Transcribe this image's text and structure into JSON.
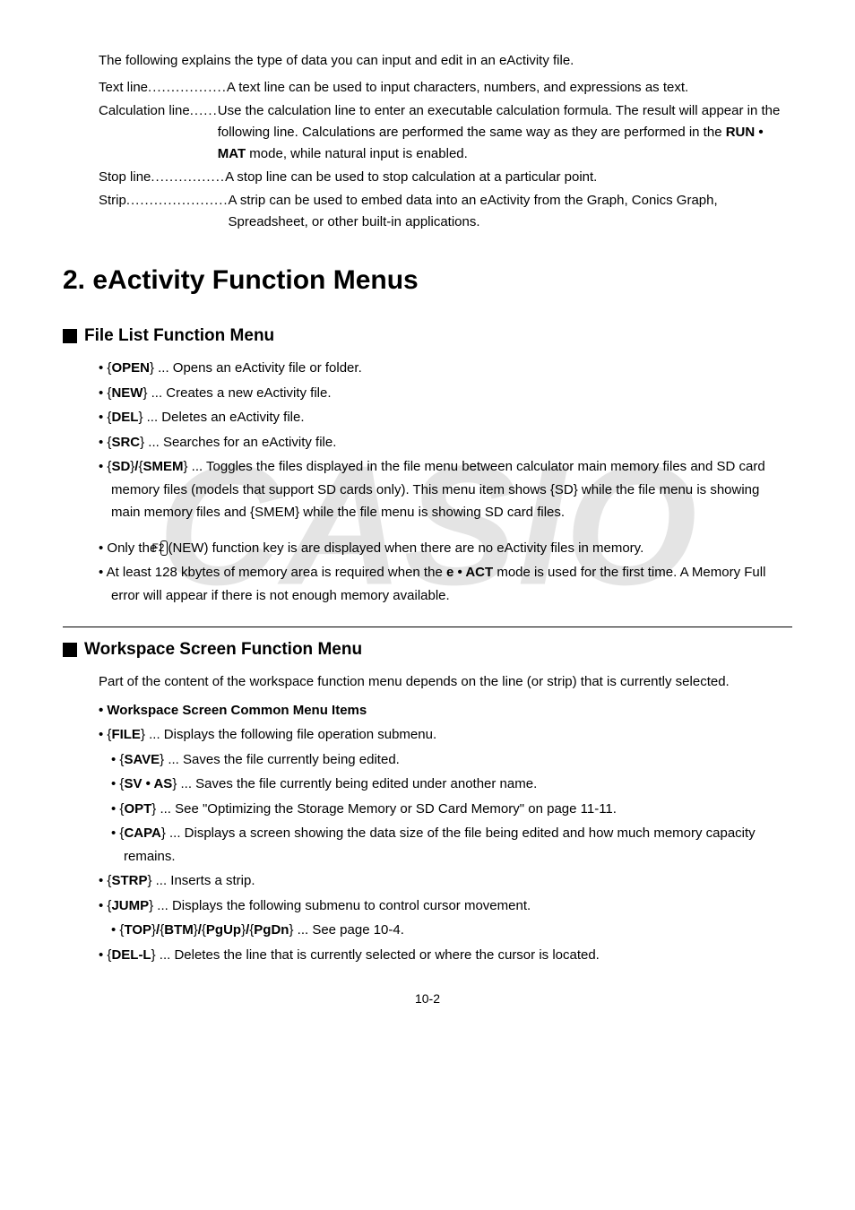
{
  "intro": {
    "lead": "The following explains the type of data you can input and edit in an eActivity file.",
    "items": [
      {
        "term": "Text line",
        "dots": ".................",
        "desc": "A text line can be used to input characters, numbers, and expressions as text."
      },
      {
        "term": "Calculation line",
        "dots": "......",
        "desc_html": "Use the calculation line to enter an executable calculation formula. The result will appear in the following line. Calculations are performed the same way as they are performed in the <b>RUN • MAT</b> mode, while natural input is enabled."
      },
      {
        "term": "Stop line",
        "dots": "................",
        "desc": "A stop line can be used to stop calculation at a particular point."
      },
      {
        "term": "Strip ",
        "dots": "......................",
        "desc": "A strip can be used to embed data into an eActivity from the Graph, Conics Graph, Spreadsheet, or other built-in applications."
      }
    ]
  },
  "section_title": "2. eActivity Function Menus",
  "file_list": {
    "heading": "File List Function Menu",
    "items": [
      {
        "html": "{<b>OPEN</b>} ... Opens an eActivity file or folder."
      },
      {
        "html": "{<b>NEW</b>} ... Creates a new eActivity file."
      },
      {
        "html": "{<b>DEL</b>} ... Deletes an eActivity file."
      },
      {
        "html": "{<b>SRC</b>} ... Searches for an eActivity file."
      },
      {
        "html": "{<b>SD</b>}<b>/</b>{<b>SMEM</b>} ... Toggles the files displayed in the file menu between calculator main memory files and SD card memory files (models that support SD cards only). This menu item shows {SD} while the file menu is showing main memory files and {SMEM} while the file menu is showing SD card files."
      }
    ],
    "note1_pre": "Only the ",
    "note1_key": "F2",
    "note1_post": "(NEW) function key is are displayed when there are no eActivity files in memory.",
    "note2": "At least 128 kbytes of memory area is required when the <b>e • ACT</b> mode is used for the first time. A Memory Full error will appear if there is not enough memory available."
  },
  "workspace": {
    "heading": "Workspace Screen Function Menu",
    "lead": "Part of the content of the workspace function menu depends on the line (or strip) that is currently selected.",
    "common_heading": "Workspace Screen Common Menu Items",
    "items": [
      {
        "html": "{<b>FILE</b>} ... Displays the following file operation submenu.",
        "sub": [
          {
            "html": "{<b>SAVE</b>} ... Saves the file currently being edited."
          },
          {
            "html": "{<b>SV • AS</b>} ... Saves the file currently being edited under another name."
          },
          {
            "html": "{<b>OPT</b>} ... See \"Optimizing the Storage Memory or SD Card Memory\" on page 11-11."
          },
          {
            "html": "{<b>CAPA</b>} ... Displays a screen showing the data size of the file being edited and how much memory capacity remains."
          }
        ]
      },
      {
        "html": "{<b>STRP</b>} ... Inserts a strip."
      },
      {
        "html": "{<b>JUMP</b>} ... Displays the following submenu to control cursor movement.",
        "sub": [
          {
            "html": "{<b>TOP</b>}<b>/</b>{<b>BTM</b>}<b>/</b>{<b>PgUp</b>}<b>/</b>{<b>PgDn</b>} ... See page 10-4."
          }
        ]
      },
      {
        "html": "{<b>DEL-L</b>} ... Deletes the line that is currently selected or where the cursor is located."
      }
    ]
  },
  "pagenum": "10-2",
  "watermark": "CASIO"
}
